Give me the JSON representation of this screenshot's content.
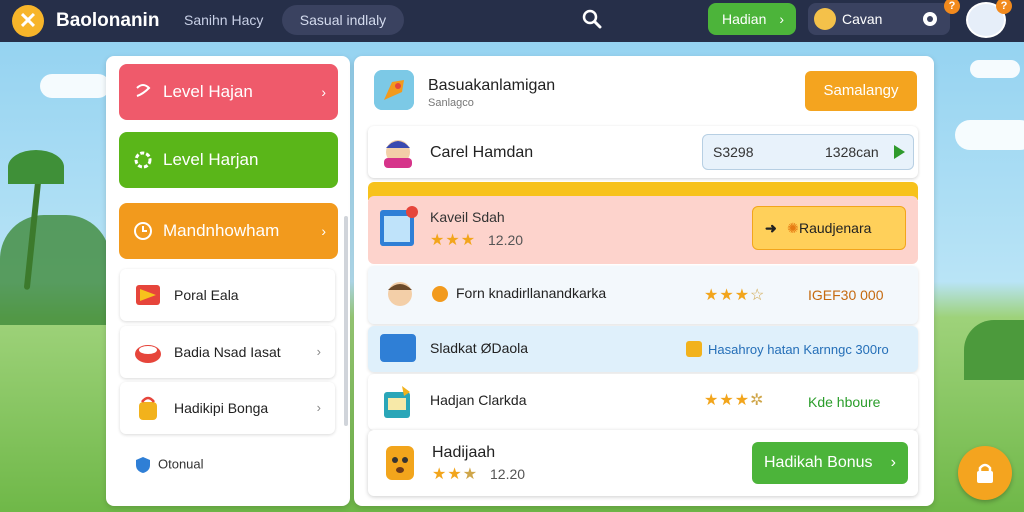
{
  "app": {
    "brand": "Baolonanin",
    "logo_glyph": "✕",
    "nav_link": "Sanihn Hacy",
    "nav_pill": "Sasual indlaly",
    "top_button": "Hadian",
    "user_name": "Cavan",
    "badges": [
      "?",
      "?"
    ]
  },
  "left_panel": {
    "buttons": [
      {
        "label": "Level Hajan",
        "color": "#ef5a6b"
      },
      {
        "label": "Level Harjan",
        "color": "#5ab619"
      },
      {
        "label": "Mandnhowham",
        "color": "#f29a1d"
      }
    ],
    "items": [
      {
        "label": "Poral Eala"
      },
      {
        "label": "Badia Nsad Iasat"
      },
      {
        "label": "Hadikipi Bonga"
      }
    ],
    "footer": "Otonual"
  },
  "main": {
    "header": {
      "title": "Basuakanlamigan",
      "subtitle": "Sanlagco",
      "button": "Samalangy"
    },
    "rows": {
      "r1": {
        "title": "Carel Hamdan",
        "field_left": "S3298",
        "field_right": "1328can"
      },
      "r2": {
        "title": "Kaveil Sdah",
        "stars": "★★★",
        "number": "12.20",
        "button": "Raudjenara"
      },
      "r3": {
        "title": "Forn knadirllanandkarka",
        "stars_full": "★★★",
        "stars_dim": "☆",
        "value": "IGEF30 000"
      },
      "r4": {
        "title": "Sladkat ØDaola",
        "value": "Hasahroy hatan Karnngc 300ro"
      },
      "r5": {
        "title": "Hadjan Clarkda",
        "stars_full": "★★★",
        "stars_dim": "✲",
        "value": "Kde hboure"
      },
      "r6": {
        "title": "Hadijaah",
        "stars_full": "★★",
        "stars_dim": "★",
        "number": "12.20",
        "button": "Hadikah Bonus"
      }
    }
  },
  "colors": {
    "topbar": "#262f49",
    "accent_orange": "#f4a41f",
    "accent_green": "#4cb43a",
    "accent_red": "#ef5a6b"
  }
}
